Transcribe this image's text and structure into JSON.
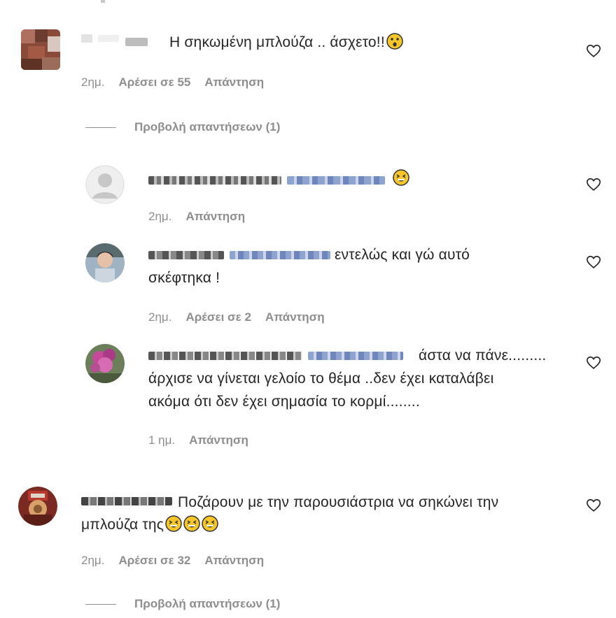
{
  "comments": [
    {
      "text": "Η σηκωμένη μπλούζα .. άσχετο!!",
      "time": "2ημ.",
      "likes": "Αρέσει σε 55",
      "reply": "Απάντηση",
      "view_replies": "Προβολή απαντήσεων (1)"
    },
    {
      "time": "2ημ.",
      "reply": "Απάντηση"
    },
    {
      "text_line1": "εντελώς και γώ αυτό",
      "text_line2": "σκέφτηκα !",
      "time": "2ημ.",
      "likes": "Αρέσει σε 2",
      "reply": "Απάντηση"
    },
    {
      "text_line1": "άστα να πάνε.........",
      "text_line2": "άρχισε να γίνεται γελοίο το θέμα ..δεν έχει καταλάβει",
      "text_line3": "ακόμα ότι δεν έχει σημασία το κορμί........",
      "time": "1 ημ.",
      "reply": "Απάντηση"
    },
    {
      "text_line1": "Ποζάρουν με την παρουσιάστρια να σηκώνει την",
      "text_line2": "μπλούζα της",
      "time": "2ημ.",
      "likes": "Αρέσει σε 32",
      "reply": "Απάντηση",
      "view_replies": "Προβολή απαντήσεων (1)"
    }
  ],
  "icons": {
    "like": "heart-outline-icon",
    "avatar_default": "default-avatar-icon"
  },
  "colors": {
    "text": "#262626",
    "meta": "#8e8e8e",
    "redacted": "#9aa8c8"
  }
}
